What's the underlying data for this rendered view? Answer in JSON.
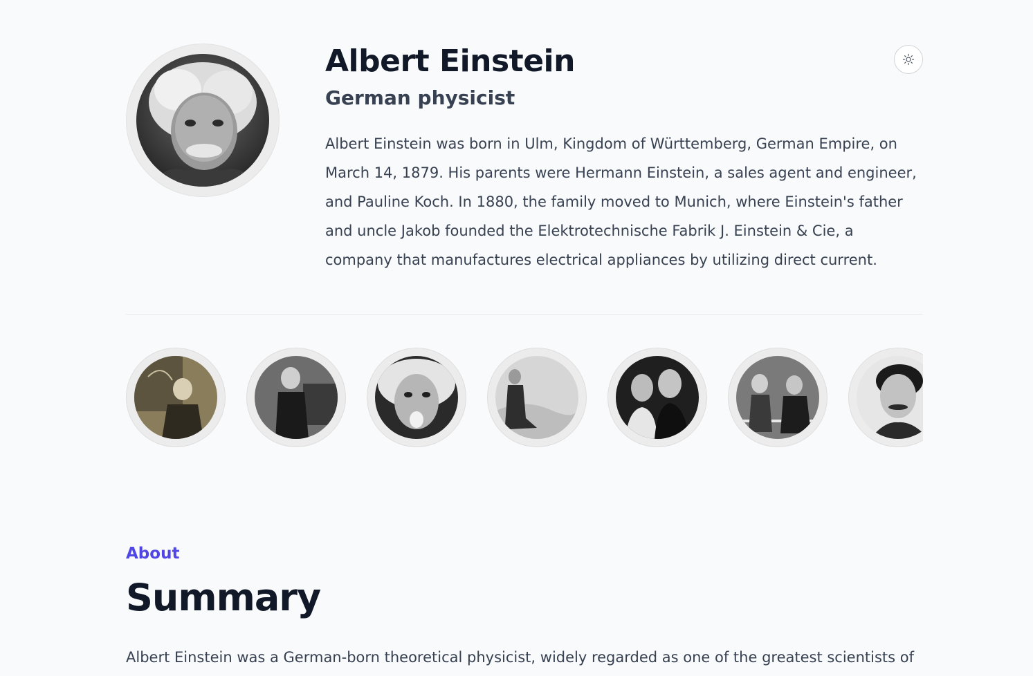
{
  "profile": {
    "name": "Albert Einstein",
    "subtitle": "German physicist",
    "bio": "Albert Einstein was born in Ulm, Kingdom of Württemberg, German Empire, on March 14, 1879. His parents were Hermann Einstein, a sales agent and engineer, and Pauline Koch. In 1880, the family moved to Munich, where Einstein's father and uncle Jakob founded the Elektrotechnische Fabrik J. Einstein & Cie, a company that manufactures electrical appliances by utilizing direct current.",
    "avatar_icon": "portrait-photo"
  },
  "header": {
    "theme_toggle_icon": "sun-icon"
  },
  "gallery": {
    "items": [
      {
        "icon": "photo-einstein-blackboard"
      },
      {
        "icon": "photo-child-portrait"
      },
      {
        "icon": "photo-tongue-out"
      },
      {
        "icon": "photo-child-seated-landscape"
      },
      {
        "icon": "photo-couple-portrait"
      },
      {
        "icon": "photo-group-on-ship"
      },
      {
        "icon": "photo-young-portrait"
      }
    ]
  },
  "about": {
    "eyebrow": "About",
    "title": "Summary",
    "text": "Albert Einstein was a German-born theoretical physicist, widely regarded as one of the greatest scientists of"
  },
  "colors": {
    "accent": "#4f46e5",
    "background": "#f9fafb",
    "heading": "#111827",
    "body": "#374151"
  }
}
